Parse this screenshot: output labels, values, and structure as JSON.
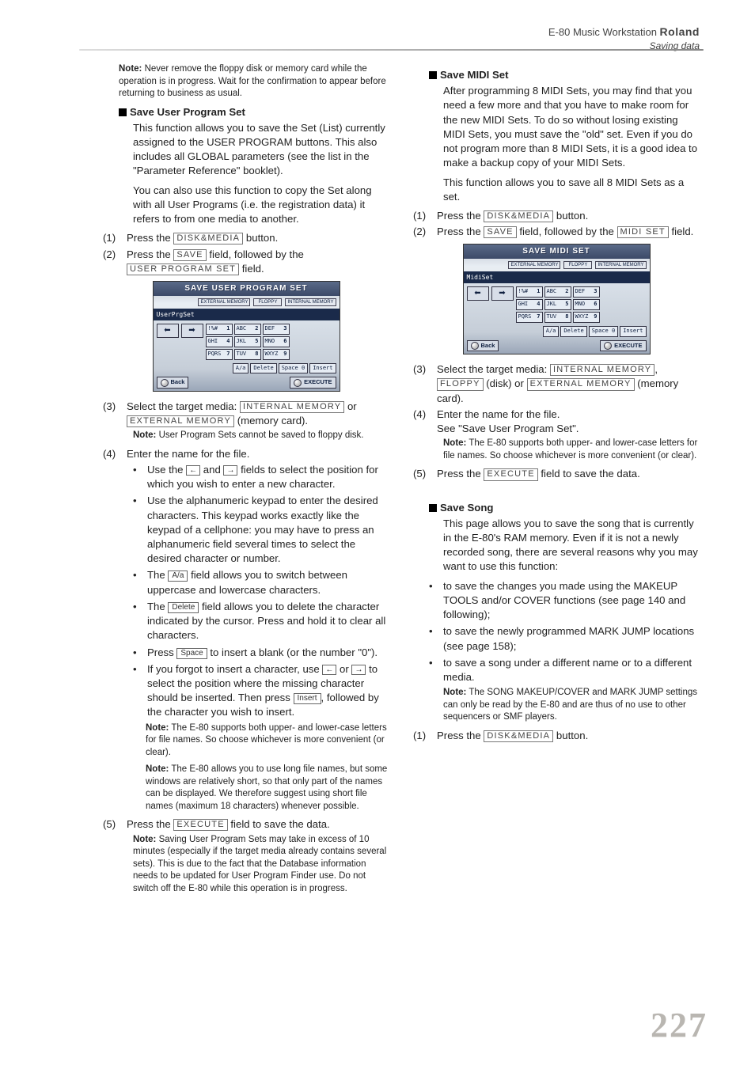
{
  "header": {
    "product": "E-80 Music Workstation",
    "brand": "Roland",
    "subtitle": "Saving data"
  },
  "pagenum": "227",
  "button_labels": {
    "disk_media": "DISK&MEDIA",
    "save": "SAVE",
    "user_program_set": "USER PROGRAM SET",
    "midi_set": "MIDI SET",
    "internal_memory": "INTERNAL MEMORY",
    "external_memory": "EXTERNAL MEMORY",
    "floppy": "FLOPPY",
    "aa": "A/a",
    "delete": "Delete",
    "space": "Space",
    "insert": "Insert",
    "execute": "EXECUTE",
    "arrow_left": "←",
    "arrow_right": "→"
  },
  "left": {
    "opening_note_label": "Note:",
    "opening_note": " Never remove the floppy disk or memory card while the operation is in progress. Wait for the confirmation to appear before returning to business as usual.",
    "h_user_prog": "Save User Program Set",
    "p1": "This function allows you to save the Set (List) currently assigned to the USER PROGRAM buttons. This also includes all GLOBAL parameters (see the list in the \"Parameter Reference\" booklet).",
    "p2": "You can also use this function to copy the Set along with all User Programs (i.e. the registration data) it refers to from one media to another.",
    "s1_pre": "Press the ",
    "s1_post": " button.",
    "s2_pre": "Press the ",
    "s2_mid": " field, followed by the ",
    "s2_post": " field.",
    "s3_pre": "Select the target media: ",
    "s3_mid1": " or ",
    "s3_mid2": " (memory card).",
    "s3_note_label": "Note:",
    "s3_note": " User Program Sets cannot be saved to floppy disk.",
    "s4": "Enter the name for the file.",
    "b1_pre": "Use the ",
    "b1_mid": " and ",
    "b1_post": " fields to select the position for which you wish to enter a new character.",
    "b2": "Use the alphanumeric keypad to enter the desired characters. This keypad works exactly like the keypad of a cellphone: you may have to press an alphanumeric field several times to select the desired character or number.",
    "b3_pre": "The ",
    "b3_post": " field allows you to switch between uppercase and lowercase characters.",
    "b4_pre": "The ",
    "b4_post": " field allows you to delete the character indicated by the cursor. Press and hold it to clear all characters.",
    "b5_pre": "Press ",
    "b5_post": " to insert a blank (or the number \"0\").",
    "b6_pre": "If you forgot to insert a character, use ",
    "b6_mid1": " or ",
    "b6_mid2": " to select the position where the missing character should be inserted. Then press ",
    "b6_post": ", followed by the character you wish to insert.",
    "note2_label": "Note:",
    "note2": " The E-80 supports both upper- and lower-case letters for file names. So choose whichever is more convenient (or clear).",
    "note3_label": "Note:",
    "note3": " The E-80 allows you to use long file names, but some windows are relatively short, so that only part of the names can be displayed. We therefore suggest using short file names (maximum 18 characters) whenever possible.",
    "s5_pre": "Press the ",
    "s5_post": " field to save the data.",
    "s5_note_label": "Note:",
    "s5_note": " Saving User Program Sets may take in excess of 10 minutes (especially if the target media already contains several sets). This is due to the fact that the Database information needs to be updated for User Program Finder use. Do not switch off the E-80 while this operation is in progress."
  },
  "right": {
    "h_midi": "Save MIDI Set",
    "p1": "After programming 8 MIDI Sets, you may find that you need a few more and that you have to make room for the new MIDI Sets. To do so without losing existing MIDI Sets, you must save the \"old\" set. Even if you do not program more than 8 MIDI Sets, it is a good idea to make a backup copy of your MIDI Sets.",
    "p2": "This function allows you to save all 8 MIDI Sets as a set.",
    "s1_pre": "Press the ",
    "s1_post": " button.",
    "s2_pre": "Press the ",
    "s2_mid": " field, followed by the ",
    "s2_post": " field.",
    "s3_pre": "Select the target media: ",
    "s3_mid1": ", ",
    "s3_mid2": " (disk) or ",
    "s3_mid3": " (memory card).",
    "s4": "Enter the name for the file.",
    "s4_see": "See \"Save User Program Set\".",
    "s4_note_label": "Note:",
    "s4_note": " The E-80 supports both upper- and lower-case letters for file names. So choose whichever is more convenient (or clear).",
    "s5_pre": "Press the ",
    "s5_post": " field to save the data.",
    "h_song": "Save Song",
    "song_p1": "This page allows you to save the song that is currently in the E-80's RAM memory. Even if it is not a newly recorded song, there are several reasons why you may want to use this function:",
    "song_b1": "to save the changes you made using the MAKEUP TOOLS and/or COVER functions (see page 140 and following);",
    "song_b2": "to save the newly programmed MARK JUMP locations (see page 158);",
    "song_b3": "to save a song under a different name or to a different media.",
    "song_note_label": "Note:",
    "song_note": " The SONG MAKEUP/COVER and MARK JUMP settings can only be read by the E-80 and are thus of no use to other sequencers or SMF players.",
    "song_s1_pre": "Press the ",
    "song_s1_post": " button."
  },
  "fig1": {
    "title": "SAVE USER PROGRAM SET",
    "media": [
      "EXTERNAL\nMEMORY",
      "FLOPPY",
      "INTERNAL\nMEMORY"
    ],
    "namebar": "UserPrgSet",
    "keys": [
      [
        "!%#",
        "1"
      ],
      [
        "ABC",
        "2"
      ],
      [
        "DEF",
        "3"
      ],
      [
        "GHI",
        "4"
      ],
      [
        "JKL",
        "5"
      ],
      [
        "MNO",
        "6"
      ],
      [
        "PQRS",
        "7"
      ],
      [
        "TUV",
        "8"
      ],
      [
        "WXYZ",
        "9"
      ]
    ],
    "editrow": [
      "A/a",
      "Delete",
      "Space 0",
      "Insert"
    ],
    "back": "Back",
    "execute": "EXECUTE"
  },
  "fig2": {
    "title": "SAVE MIDI SET",
    "media": [
      "EXTERNAL\nMEMORY",
      "FLOPPY",
      "INTERNAL\nMEMORY"
    ],
    "namebar": "MidiSet",
    "keys": [
      [
        "!%#",
        "1"
      ],
      [
        "ABC",
        "2"
      ],
      [
        "DEF",
        "3"
      ],
      [
        "GHI",
        "4"
      ],
      [
        "JKL",
        "5"
      ],
      [
        "MNO",
        "6"
      ],
      [
        "PQRS",
        "7"
      ],
      [
        "TUV",
        "8"
      ],
      [
        "WXYZ",
        "9"
      ]
    ],
    "editrow": [
      "A/a",
      "Delete",
      "Space 0",
      "Insert"
    ],
    "back": "Back",
    "execute": "EXECUTE"
  }
}
